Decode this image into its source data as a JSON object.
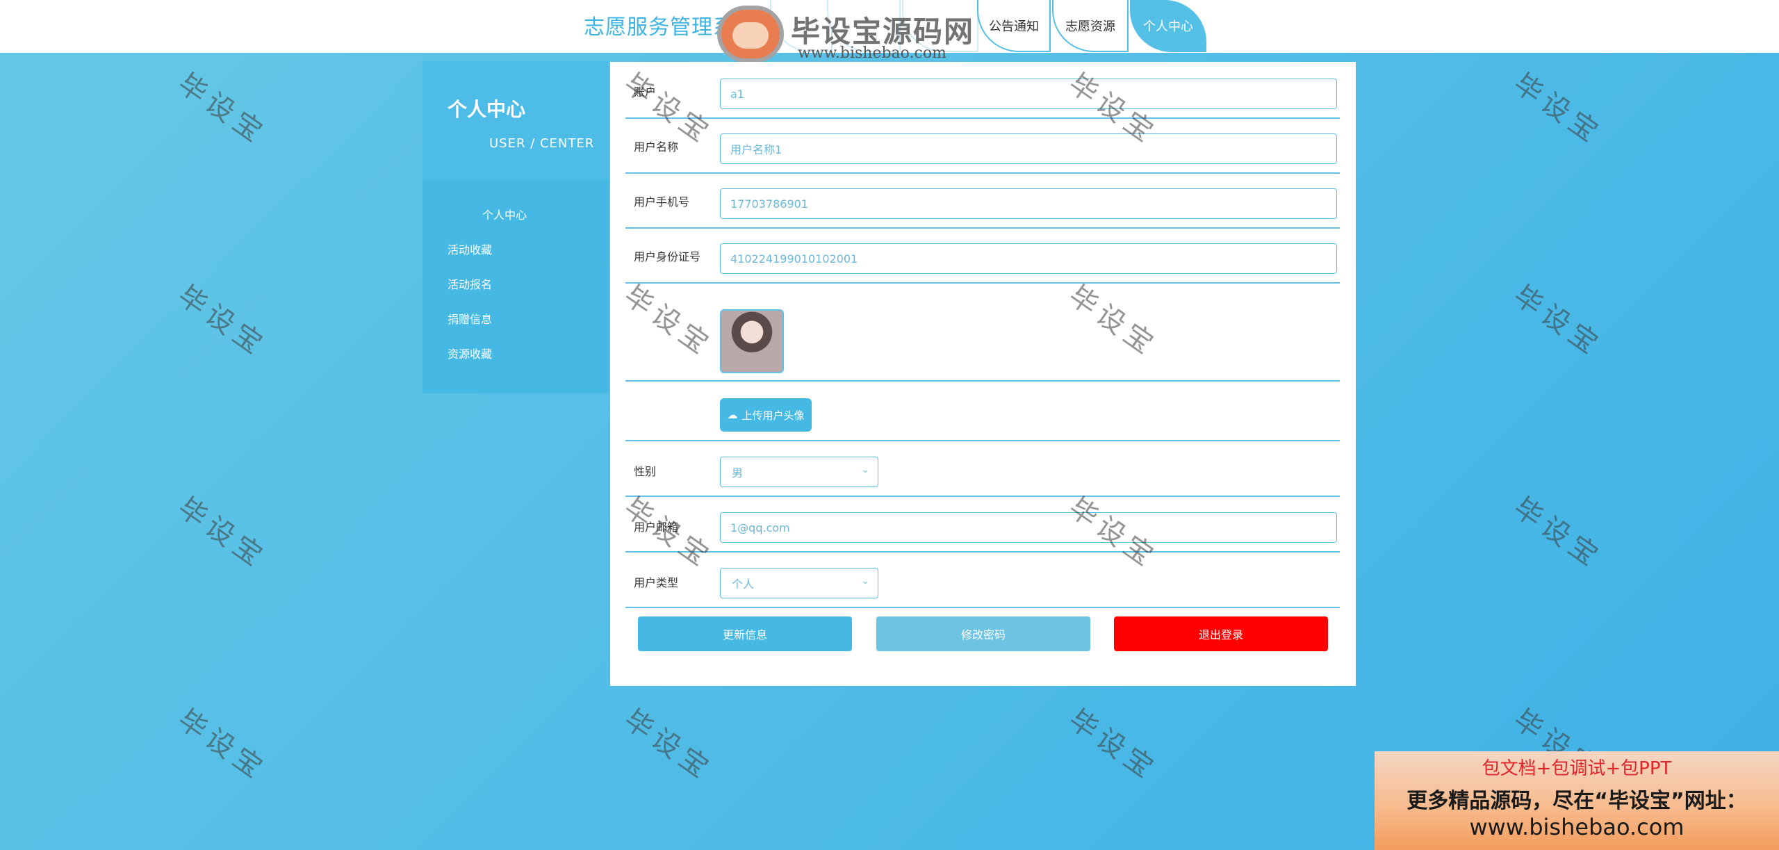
{
  "header": {
    "site_title": "志愿服务管理系统",
    "nav_tabs": [
      "公告通知",
      "志愿资源",
      "个人中心"
    ]
  },
  "logo": {
    "text": "毕设宝源码网",
    "url": "www.bishebao.com"
  },
  "sidebar": {
    "title": "个人中心",
    "subtitle": "USER / CENTER",
    "items": [
      {
        "label": "个人中心"
      },
      {
        "label": "活动收藏"
      },
      {
        "label": "活动报名"
      },
      {
        "label": "捐赠信息"
      },
      {
        "label": "资源收藏"
      }
    ]
  },
  "form": {
    "account": {
      "label": "账户",
      "value": "a1"
    },
    "username": {
      "label": "用户名称",
      "value": "用户名称1"
    },
    "phone": {
      "label": "用户手机号",
      "value": "17703786901"
    },
    "id_card": {
      "label": "用户身份证号",
      "value": "410224199010102001"
    },
    "upload_label": "上传用户头像",
    "gender": {
      "label": "性别",
      "value": "男"
    },
    "email": {
      "label": "用户邮箱",
      "value": "1@qq.com"
    },
    "user_type": {
      "label": "用户类型",
      "value": "个人"
    }
  },
  "actions": {
    "update": "更新信息",
    "change_password": "修改密码",
    "logout": "退出登录"
  },
  "colors": {
    "accent": "#46b8e4",
    "logout": "#ff0000",
    "password": "#6cc4e2"
  },
  "watermark": "毕设宝",
  "promo": {
    "line1": "包文档+包调试+包PPT",
    "line2": "更多精品源码，尽在“毕设宝”网址：",
    "line3": "www.bishebao.com"
  }
}
